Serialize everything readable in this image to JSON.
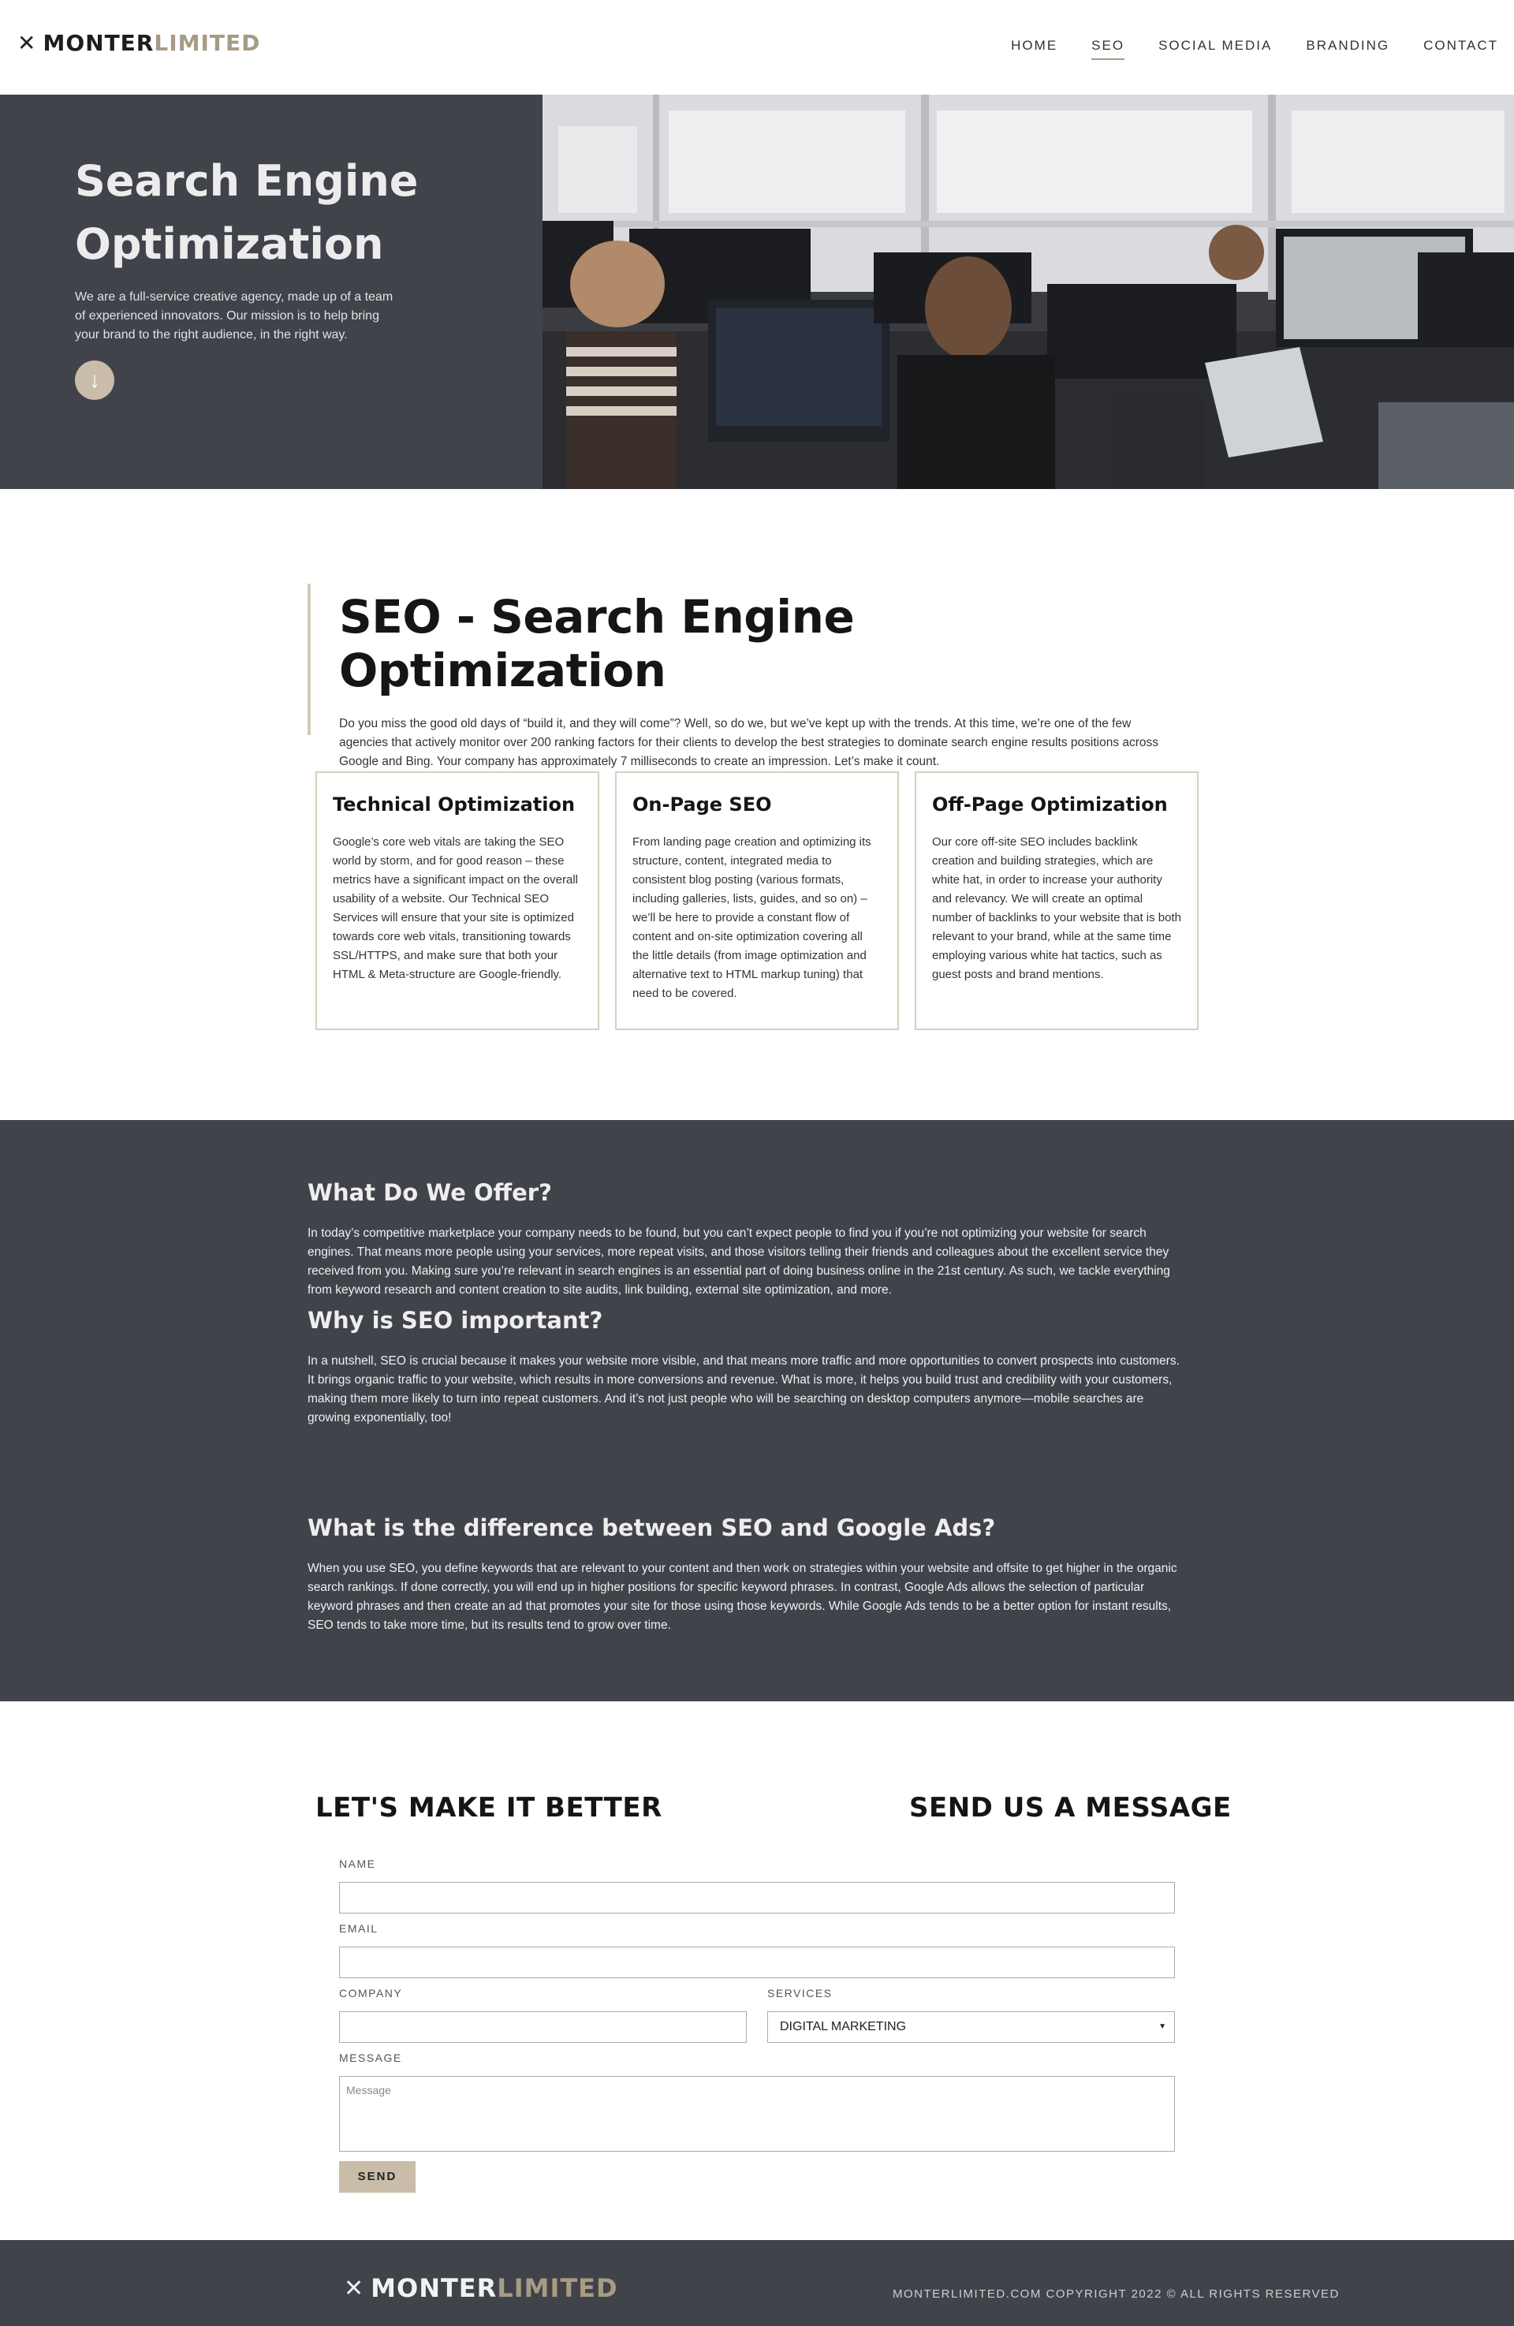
{
  "header": {
    "logo": {
      "part1": "MONTER",
      "part2": "LIMITED",
      "mark": "✕"
    },
    "nav": [
      {
        "label": "HOME"
      },
      {
        "label": "SEO"
      },
      {
        "label": "SOCIAL MEDIA"
      },
      {
        "label": "BRANDING"
      },
      {
        "label": "CONTACT"
      }
    ]
  },
  "hero": {
    "title": "Search Engine Optimization",
    "text": "We are a full-service creative agency, made up of a team of experienced innovators. Our mission is to help bring your brand to the right audience, in the right way.",
    "arrow_icon": "arrow-down-icon"
  },
  "intro": {
    "title": "SEO - Search Engine Optimization",
    "text": "Do you miss the good old days of “build it, and they will come”? Well, so do we, but we’ve kept up with the trends. At this time, we’re one of the few agencies that actively monitor over 200 ranking factors for their clients to develop the best strategies to dominate search engine results positions across Google and Bing. Your company has approximately 7 milliseconds to create an impression. Let’s make it count."
  },
  "cards": [
    {
      "title": "Technical Optimization",
      "text": "Google’s core web vitals are taking the SEO world by storm, and for good reason – these metrics have a significant impact on the overall usability of a website. Our Technical SEO Services will ensure that your site is optimized towards core web vitals, transitioning towards SSL/HTTPS, and make sure that both your HTML & Meta-structure are Google-friendly."
    },
    {
      "title": "On-Page SEO",
      "text": "From landing page creation and optimizing its structure, content, integrated media to consistent blog posting (various formats, including galleries, lists, guides, and so on) – we’ll be here to provide a constant flow of content and on-site optimization covering all the little details (from image optimization and alternative text to HTML markup tuning) that need to be covered."
    },
    {
      "title": "Off-Page Optimization",
      "text": "Our core off-site SEO includes backlink creation and building strategies, which are white hat, in order to increase your authority and relevancy. We will create an optimal number of backlinks to your website that is both relevant to your brand, while at the same time employing various white hat tactics, such as guest posts and brand mentions."
    }
  ],
  "offer": {
    "title": "What Do We Offer?",
    "text": "In today’s competitive marketplace your company needs to be found, but you can’t expect people to find you if you’re not optimizing your website for search engines. That means more people using your services, more repeat visits, and those visitors telling their friends and colleagues about the excellent service they received from you. Making sure you’re relevant in search engines is an essential part of doing business online in the 21st century. As such, we tackle everything from keyword research and content creation to site audits, link building, external site optimization, and more."
  },
  "why": {
    "title": "Why is SEO important?",
    "text": "In a nutshell, SEO is crucial because it makes your website more visible, and that means more traffic and more opportunities to convert prospects into customers. It brings organic traffic to your website, which results in more conversions and revenue. What is more, it helps you build trust and credibility with your customers, making them more likely to turn into repeat customers. And it’s not just people who will be searching on desktop computers anymore—mobile searches are growing exponentially, too!"
  },
  "difference": {
    "title": "What is the difference between SEO and Google Ads?",
    "text": "When you use SEO, you define keywords that are relevant to your content and then work on strategies within your website and offsite to get higher in the organic search rankings. If done correctly, you will end up in higher positions for specific keyword phrases. In contrast, Google Ads allows the selection of particular keyword phrases and then create an ad that promotes your site for those using those keywords. While Google Ads tends to be a better option for instant results, SEO tends to take more time, but its results tend to grow over time."
  },
  "contact": {
    "left_heading": "LET'S MAKE IT BETTER",
    "right_heading": "SEND US A MESSAGE",
    "name_label": "NAME",
    "email_label": "EMAIL",
    "company_label": "COMPANY",
    "services_label": "SERVICES",
    "services_value": "DIGITAL MARKETING",
    "message_label": "MESSAGE",
    "message_placeholder": "Message",
    "send_label": "SEND"
  },
  "footer": {
    "logo": {
      "part1": "MONTER",
      "part2": "LIMITED",
      "mark": "✕"
    },
    "copyright": "MONTERLIMITED.COM COPYRIGHT 2022 © ALL RIGHTS RESERVED"
  },
  "colors": {
    "dark": "#41434b",
    "accent": "#a79b83",
    "button": "#c9bca8"
  }
}
